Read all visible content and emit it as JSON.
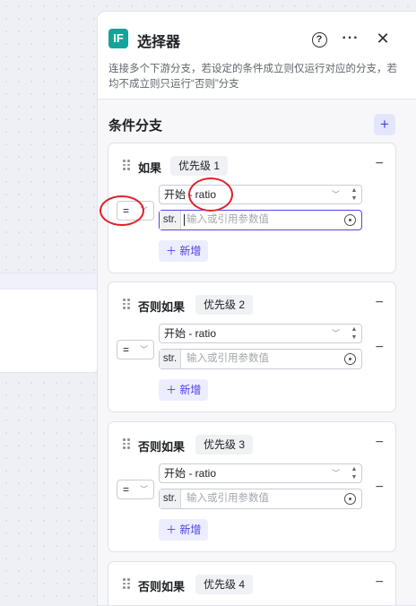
{
  "panel": {
    "badge": "IF",
    "title": "选择器",
    "help_glyph": "?",
    "more_glyph": "···",
    "close_glyph": "✕",
    "description": "连接多个下游分支，若设定的条件成立则仅运行对应的分支，若均不成立则只运行“否则”分支"
  },
  "section": {
    "title": "条件分支",
    "add_glyph": "+"
  },
  "branches": [
    {
      "label": "如果",
      "priority": "优先级 1",
      "operator": "=",
      "lhs": "开始 - ratio",
      "rhs_type": "str.",
      "rhs_placeholder": "输入或引用参数值",
      "add_label": "＋ 新增"
    },
    {
      "label": "否则如果",
      "priority": "优先级 2",
      "operator": "=",
      "lhs": "开始 - ratio",
      "rhs_type": "str.",
      "rhs_placeholder": "输入或引用参数值",
      "add_label": "＋ 新增"
    },
    {
      "label": "否则如果",
      "priority": "优先级 3",
      "operator": "=",
      "lhs": "开始 - ratio",
      "rhs_type": "str.",
      "rhs_placeholder": "输入或引用参数值",
      "add_label": "＋ 新增"
    },
    {
      "label": "否则如果",
      "priority": "优先级 4"
    }
  ],
  "icons": {
    "minus": "−",
    "chevron": "﹀",
    "spin_up": "▲",
    "spin_down": "▼"
  },
  "colors": {
    "accent": "#4e40e5",
    "badge": "#14a39a",
    "annotation": "#e0212b"
  }
}
